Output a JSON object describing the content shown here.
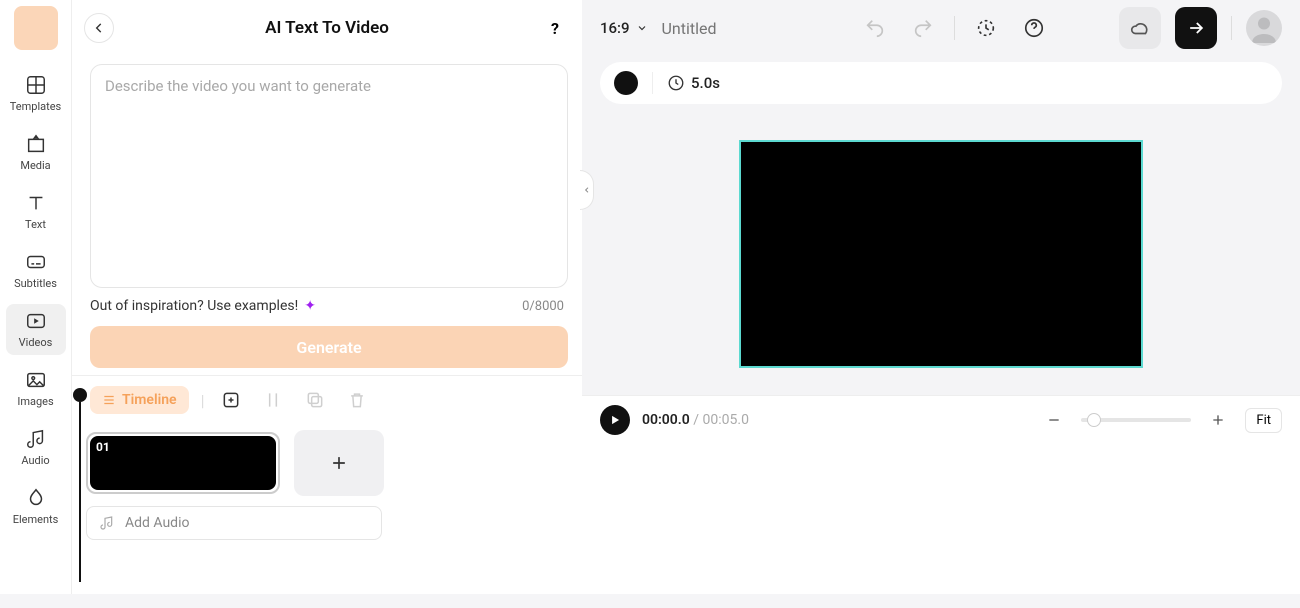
{
  "sidebar": {
    "items": [
      {
        "label": "Templates"
      },
      {
        "label": "Media"
      },
      {
        "label": "Text"
      },
      {
        "label": "Subtitles"
      },
      {
        "label": "Videos"
      },
      {
        "label": "Images"
      },
      {
        "label": "Audio"
      },
      {
        "label": "Elements"
      }
    ]
  },
  "panel": {
    "title": "AI Text To Video",
    "placeholder": "Describe the video you want to generate",
    "inspire": "Out of inspiration? Use examples!",
    "counter": "0/8000",
    "generate": "Generate",
    "help": "?"
  },
  "topbar": {
    "aspect": "16:9",
    "title_placeholder": "Untitled"
  },
  "scene": {
    "duration": "5.0s"
  },
  "playback": {
    "current": "00:00.0",
    "total": "00:05.0",
    "fit": "Fit"
  },
  "timeline": {
    "label": "Timeline",
    "clip_num": "01",
    "add_audio": "Add Audio"
  }
}
